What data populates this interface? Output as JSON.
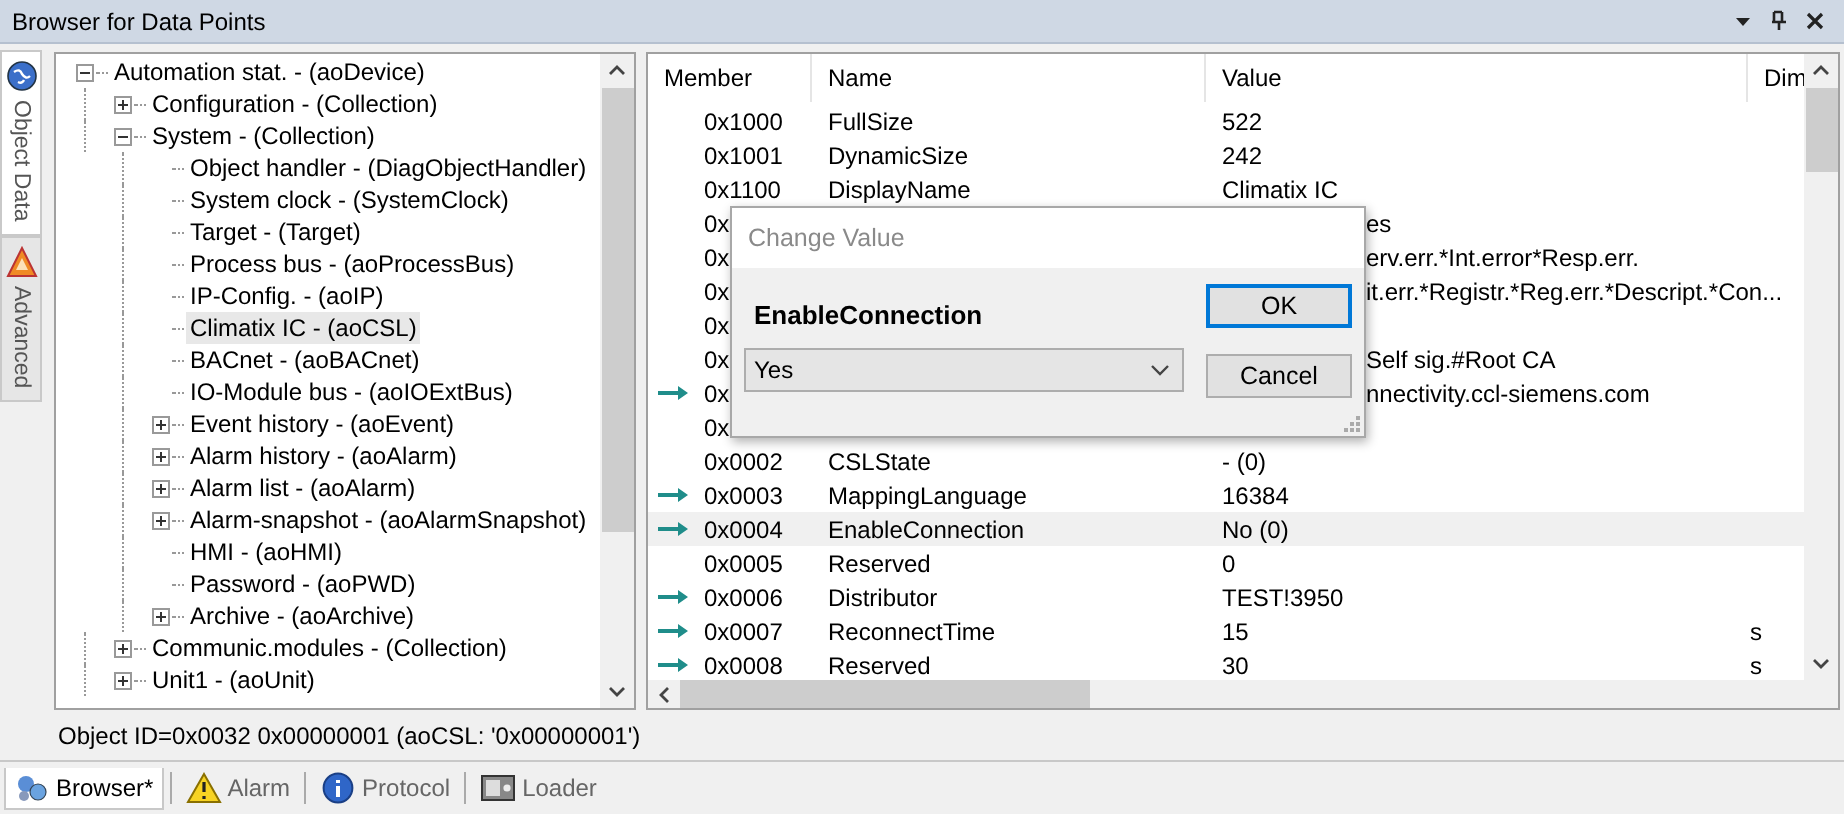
{
  "window": {
    "title": "Browser for Data Points"
  },
  "side_tabs": [
    {
      "label": "Object Data",
      "selected": true,
      "kind": "globe"
    },
    {
      "label": "Advanced",
      "selected": false,
      "kind": "tool"
    }
  ],
  "tree": {
    "items": [
      {
        "label": "Automation stat. - (aoDevice)",
        "kind": "node",
        "expanded": true,
        "selected": false,
        "children": [
          {
            "label": "Configuration - (Collection)",
            "kind": "node",
            "expanded": false,
            "selected": false
          },
          {
            "label": "System - (Collection)",
            "kind": "node",
            "expanded": true,
            "selected": false,
            "children": [
              {
                "label": "Object handler - (DiagObjectHandler)",
                "kind": "leaf",
                "selected": false
              },
              {
                "label": "System clock - (SystemClock)",
                "kind": "leaf",
                "selected": false
              },
              {
                "label": "Target - (Target)",
                "kind": "leaf",
                "selected": false
              },
              {
                "label": "Process bus - (aoProcessBus)",
                "kind": "leaf",
                "selected": false
              },
              {
                "label": "IP-Config. - (aoIP)",
                "kind": "leaf",
                "selected": false
              },
              {
                "label": "Climatix IC - (aoCSL)",
                "kind": "leaf",
                "selected": true
              },
              {
                "label": "BACnet - (aoBACnet)",
                "kind": "leaf",
                "selected": false
              },
              {
                "label": "IO-Module bus - (aoIOExtBus)",
                "kind": "leaf",
                "selected": false
              },
              {
                "label": "Event history - (aoEvent)",
                "kind": "node",
                "expanded": false,
                "selected": false
              },
              {
                "label": "Alarm history - (aoAlarm)",
                "kind": "node",
                "expanded": false,
                "selected": false
              },
              {
                "label": "Alarm list - (aoAlarm)",
                "kind": "node",
                "expanded": false,
                "selected": false
              },
              {
                "label": "Alarm-snapshot - (aoAlarmSnapshot)",
                "kind": "node",
                "expanded": false,
                "selected": false
              },
              {
                "label": "HMI - (aoHMI)",
                "kind": "leaf",
                "selected": false
              },
              {
                "label": "Password - (aoPWD)",
                "kind": "leaf",
                "selected": false
              },
              {
                "label": "Archive - (aoArchive)",
                "kind": "node",
                "expanded": false,
                "selected": false
              }
            ]
          },
          {
            "label": "Communic.modules - (Collection)",
            "kind": "node",
            "expanded": false,
            "selected": false
          },
          {
            "label": "Unit1 - (aoUnit)",
            "kind": "node",
            "expanded": false,
            "selected": false
          }
        ]
      }
    ]
  },
  "table": {
    "columns": [
      "Member",
      "Name",
      "Value",
      "Dim"
    ],
    "rows": [
      {
        "kind": "row",
        "member": "0x1000",
        "name": "FullSize",
        "value": "522",
        "arrow": false,
        "selected": false
      },
      {
        "kind": "row",
        "member": "0x1001",
        "name": "DynamicSize",
        "value": "242",
        "arrow": false,
        "selected": false
      },
      {
        "kind": "row",
        "member": "0x1100",
        "name": "DisplayName",
        "value": "Climatix IC",
        "arrow": false,
        "selected": false
      },
      {
        "kind": "covered",
        "member": "0x",
        "value": "es",
        "arrow": false,
        "selected": false
      },
      {
        "kind": "covered",
        "member": "0x",
        "value": "erv.err.*Int.error*Resp.err.",
        "arrow": false,
        "selected": false
      },
      {
        "kind": "covered",
        "member": "0x",
        "value": "it.err.*Registr.*Reg.err.*Descript.*Con...",
        "arrow": false,
        "selected": false
      },
      {
        "kind": "covered",
        "member": "0x",
        "arrow": false,
        "selected": false
      },
      {
        "kind": "covered",
        "member": "0x",
        "value": "Self sig.#Root CA",
        "arrow": false,
        "selected": false
      },
      {
        "kind": "covered",
        "member": "0x",
        "value": "nnectivity.ccl-siemens.com",
        "arrow": true,
        "selected": false
      },
      {
        "kind": "covered",
        "member": "0x",
        "arrow": false,
        "selected": false
      },
      {
        "kind": "row",
        "member": "0x0002",
        "name": "CSLState",
        "value": "- (0)",
        "arrow": false,
        "selected": false
      },
      {
        "kind": "row",
        "member": "0x0003",
        "name": "MappingLanguage",
        "value": "16384",
        "arrow": true,
        "selected": false
      },
      {
        "kind": "row",
        "member": "0x0004",
        "name": "EnableConnection",
        "value": "No (0)",
        "arrow": true,
        "selected": true
      },
      {
        "kind": "row",
        "member": "0x0005",
        "name": "Reserved",
        "value": "0",
        "arrow": false,
        "selected": false
      },
      {
        "kind": "row",
        "member": "0x0006",
        "name": "Distributor",
        "value": "TEST!3950",
        "arrow": true,
        "selected": false
      },
      {
        "kind": "row",
        "member": "0x0007",
        "name": "ReconnectTime",
        "value": "15",
        "dim": "s",
        "arrow": true,
        "selected": false
      },
      {
        "kind": "row",
        "member": "0x0008",
        "name": "Reserved",
        "value": "30",
        "dim": "s",
        "arrow": true,
        "selected": false
      }
    ]
  },
  "dialog": {
    "title": "Change Value",
    "label": "EnableConnection",
    "value": "Yes",
    "buttons": [
      "OK",
      "Cancel"
    ]
  },
  "status_bar": "Object ID=0x0032 0x00000001 (aoCSL: '0x00000001')",
  "bottom_tabs": [
    {
      "label": "Browser*",
      "selected": true,
      "kind": "browser"
    },
    {
      "label": "Alarm",
      "selected": false,
      "kind": "alarm"
    },
    {
      "label": "Protocol",
      "selected": false,
      "kind": "info"
    },
    {
      "label": "Loader",
      "selected": false,
      "kind": "loader"
    }
  ]
}
